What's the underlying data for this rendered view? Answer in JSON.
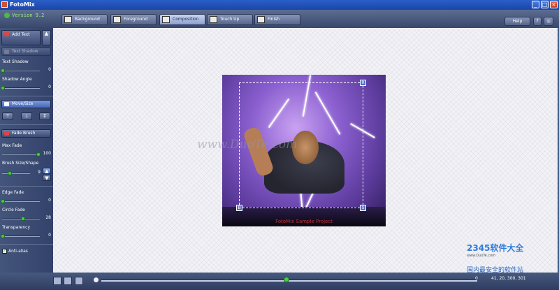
{
  "window": {
    "title": "FotoMix",
    "min": "_",
    "max": "□",
    "close": "×"
  },
  "header": {
    "version": "Version 9.2",
    "tabs": [
      {
        "label": "Background"
      },
      {
        "label": "Foreground"
      },
      {
        "label": "Composition"
      },
      {
        "label": "Touch Up"
      },
      {
        "label": "Finish"
      }
    ],
    "help": "Help",
    "facebook": "f"
  },
  "sidebar": {
    "add_text": "Add Text",
    "text_shadow_btn": "Text Shadow",
    "text_shadow_label": "Text Shadow",
    "text_shadow_value": "0",
    "shadow_angle_label": "Shadow Angle",
    "shadow_angle_value": "0",
    "move_size": "Move/Size",
    "fade_brush": "Fade Brush",
    "max_fade_label": "Max Fade",
    "max_fade_value": "100",
    "brush_size_label": "Brush Size/Shape",
    "brush_size_value": "9",
    "edge_fade_label": "Edge Fade",
    "edge_fade_value": "0",
    "circle_fade_label": "Circle Fade",
    "circle_fade_value": "28",
    "transparency_label": "Transparency",
    "transparency_value": "0",
    "anti_alias_label": "Anti-alias",
    "anti_alias_checked": true
  },
  "canvas": {
    "photo_caption": "FotoMix Sample Project",
    "watermark": "www.DuoTe.com",
    "logo_text": "2345软件大全",
    "logo_url": "www.DuoTe.com",
    "logo_tagline": "国内最安全的软件站",
    "handle_tr": "R",
    "handle_bl": "B",
    "handle_br": "S"
  },
  "bottombar": {
    "zoom_value": "0",
    "coords": "41, 20, 300, 301"
  },
  "colors": {
    "accent": "#4d6dd2",
    "slider_knob": "#3fcf3f",
    "title_bar": "#1b45a8"
  }
}
